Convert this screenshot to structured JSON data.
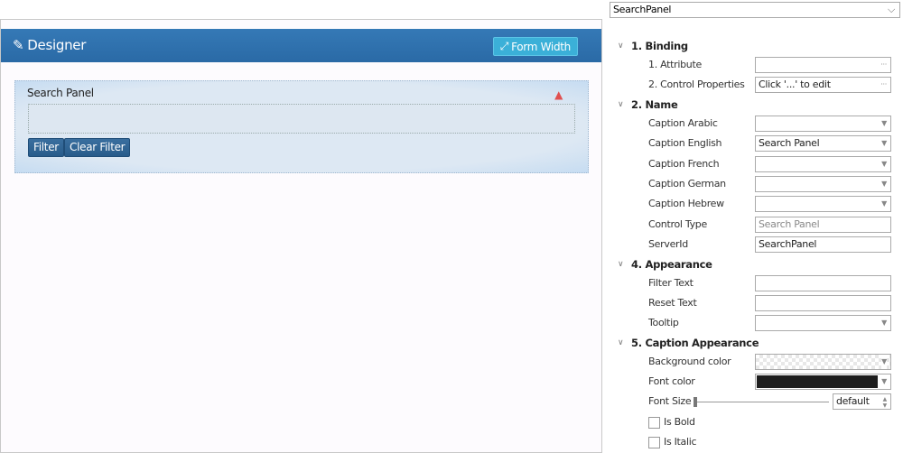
{
  "designer": {
    "title": "Designer",
    "form_width": "Form Width",
    "panel": {
      "caption": "Search Panel",
      "filter": "Filter",
      "clear_filter": "Clear Filter"
    }
  },
  "props": {
    "selected": "SearchPanel",
    "sections": [
      {
        "title": "1. Binding",
        "rows": [
          {
            "label": "1. Attribute",
            "value": "",
            "kind": "ellipsis"
          },
          {
            "label": "2. Control Properties",
            "value": "Click '...' to edit",
            "kind": "ellipsis"
          }
        ]
      },
      {
        "title": "2. Name",
        "rows": [
          {
            "label": "Caption Arabic",
            "value": ""
          },
          {
            "label": "Caption English",
            "value": "Search Panel"
          },
          {
            "label": "Caption French",
            "value": ""
          },
          {
            "label": "Caption German",
            "value": ""
          },
          {
            "label": "Caption Hebrew",
            "value": ""
          },
          {
            "label": "Control Type",
            "value": "Search Panel"
          },
          {
            "label": "ServerId",
            "value": "SearchPanel"
          }
        ]
      },
      {
        "title": "4. Appearance",
        "rows": [
          {
            "label": "Filter Text",
            "value": ""
          },
          {
            "label": "Reset Text",
            "value": ""
          },
          {
            "label": "Tooltip",
            "value": ""
          }
        ]
      },
      {
        "title": "5. Caption Appearance",
        "rows": [
          {
            "label": "Background color"
          },
          {
            "label": "Font color",
            "color": "#1e1e1e"
          },
          {
            "label": "Font Size",
            "value": "default"
          },
          {
            "label": "Is Bold",
            "checked": false
          },
          {
            "label": "Is Italic",
            "checked": false
          }
        ]
      }
    ]
  }
}
